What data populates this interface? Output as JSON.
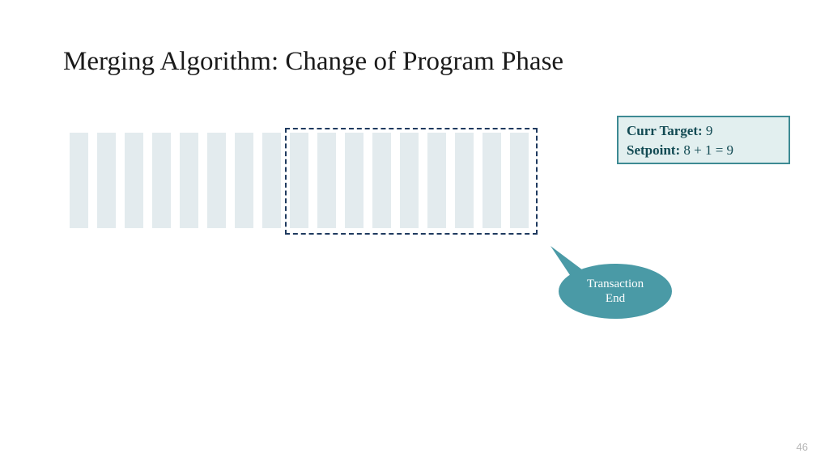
{
  "title": "Merging Algorithm: Change of Program Phase",
  "bars": {
    "count_total": 17,
    "count_in_box": 9,
    "bar_color": "#e3ebee"
  },
  "dashed_box_color": "#1f3a5f",
  "info": {
    "curr_target_label": "Curr Target: ",
    "curr_target_value": "9",
    "setpoint_label": "Setpoint: ",
    "setpoint_value": "8 + 1 = 9"
  },
  "callout": {
    "line1": "Transaction",
    "line2": "End"
  },
  "page_number": "46"
}
